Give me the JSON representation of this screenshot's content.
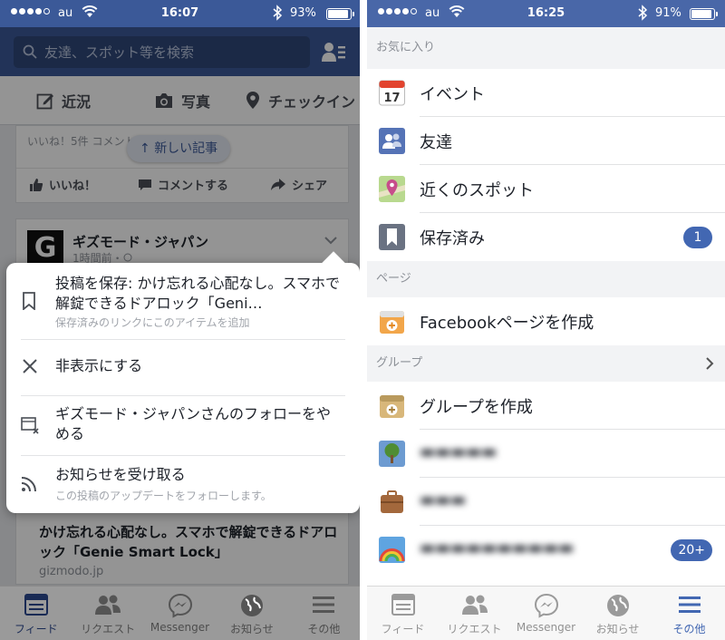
{
  "left_screen": {
    "status": {
      "carrier": "au",
      "time": "16:07",
      "battery": "93%",
      "battery_level": 0.93
    },
    "search": {
      "placeholder": "友達、スポット等を検索"
    },
    "composer": {
      "status": "近況",
      "photo": "写真",
      "checkin": "チェックイン"
    },
    "feed": {
      "card1": {
        "likes": "いいね！5件 コメント",
        "like": "いいね！",
        "comment": "コメントする",
        "share": "シェア"
      },
      "new_posts_pill": "新しい記事",
      "card2": {
        "avatar_letter": "G",
        "page_name": "ギズモード・ジャパン",
        "time": "1時間前・"
      },
      "link_preview": {
        "title": "かけ忘れる心配なし。スマホで解錠できるドアロック「Genie Smart Lock」",
        "domain": "gizmodo.jp"
      }
    },
    "menu": {
      "save": {
        "title": "投稿を保存: かけ忘れる心配なし。スマホで解錠できるドアロック「Geni…",
        "subtitle": "保存済みのリンクにこのアイテムを追加"
      },
      "hide": {
        "title": "非表示にする"
      },
      "unfollow": {
        "title": "ギズモード・ジャパンさんのフォローをやめる"
      },
      "notifications": {
        "title": "お知らせを受け取る",
        "subtitle": "この投稿のアップデートをフォローします。"
      }
    },
    "tabs": [
      "フィード",
      "リクエスト",
      "Messenger",
      "お知らせ",
      "その他"
    ],
    "active_tab": "フィード"
  },
  "right_screen": {
    "status": {
      "carrier": "au",
      "time": "16:25",
      "battery": "91%",
      "battery_level": 0.91
    },
    "sections": {
      "favorites": "お気に入り",
      "pages": "ページ",
      "groups": "グループ"
    },
    "favorites": [
      {
        "label": "イベント",
        "icon": "calendar-icon",
        "icon_text": "17"
      },
      {
        "label": "友達",
        "icon": "friends-icon"
      },
      {
        "label": "近くのスポット",
        "icon": "map-pin-icon"
      },
      {
        "label": "保存済み",
        "icon": "bookmark-icon",
        "badge": "1"
      }
    ],
    "pages": [
      {
        "label": "Facebookページを作成",
        "icon": "create-page-icon"
      }
    ],
    "groups": [
      {
        "label": "グループを作成",
        "icon": "create-group-icon"
      },
      {
        "label": "",
        "icon": "tree-icon",
        "blurred": true
      },
      {
        "label": "",
        "icon": "briefcase-icon",
        "blurred": true
      },
      {
        "label": "",
        "icon": "rainbow-icon",
        "blurred": true,
        "badge": "20+"
      }
    ],
    "tabs": [
      "フィード",
      "リクエスト",
      "Messenger",
      "お知らせ",
      "その他"
    ],
    "active_tab": "その他"
  },
  "colors": {
    "facebook_blue": "#3b5998",
    "accent_blue": "#4267b2",
    "section_bg": "#f2f3f5"
  }
}
